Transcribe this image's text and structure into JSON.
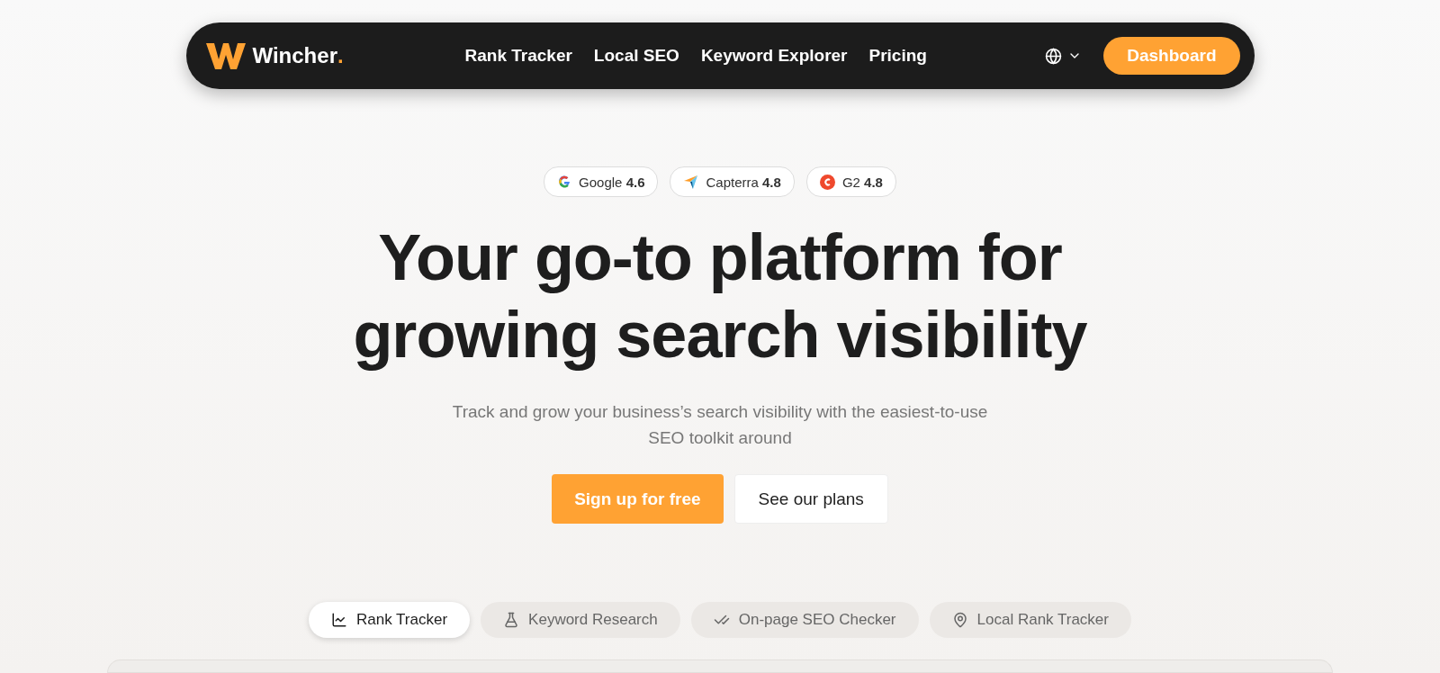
{
  "nav": {
    "brand": {
      "name": "Wincher",
      "mark": "."
    },
    "links": [
      "Rank Tracker",
      "Local SEO",
      "Keyword Explorer",
      "Pricing"
    ],
    "cta": "Dashboard"
  },
  "ratings": [
    {
      "kind": "google",
      "text": "Google **4.6**"
    },
    {
      "kind": "capterra",
      "text": "Capterra **4.8**"
    },
    {
      "kind": "g2",
      "text": "G2 **4.8**"
    }
  ],
  "hero": {
    "title_lines": [
      "Your go-to platform for",
      "growing search visibility"
    ],
    "subtitle_lines": [
      "Track and grow your business’s search visibility with the easiest-to-use",
      "SEO toolkit around"
    ],
    "primary": "Sign up for free",
    "secondary": "See our plans"
  },
  "tabs": [
    {
      "kind": "chart",
      "label": "Rank Tracker",
      "selected": true
    },
    {
      "kind": "flask",
      "label": "Keyword Research",
      "selected": false
    },
    {
      "kind": "checks",
      "label": "On-page SEO Checker",
      "selected": false
    },
    {
      "kind": "pin",
      "label": "Local Rank Tracker",
      "selected": false
    }
  ]
}
